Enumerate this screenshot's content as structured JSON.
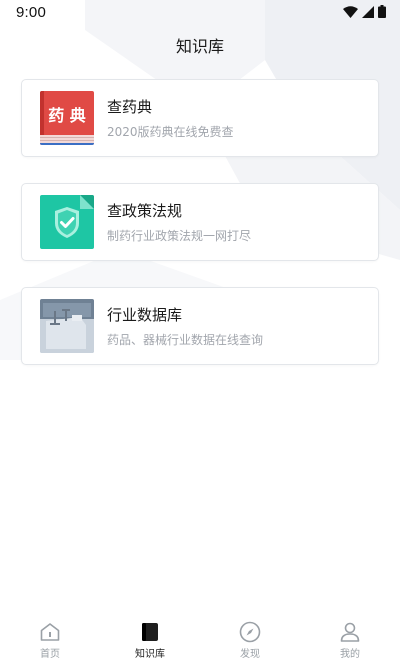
{
  "status_bar": {
    "time": "9:00"
  },
  "header": {
    "title": "知识库"
  },
  "cards": [
    {
      "title": "查药典",
      "description": "2020版药典在线免费查",
      "icon": "pharmacopoeia-book-icon",
      "icon_text": "药 典",
      "icon_color": "#e04a45"
    },
    {
      "title": "查政策法规",
      "description": "制药行业政策法规一网打尽",
      "icon": "policy-shield-check-icon",
      "icon_color": "#1ec6a4"
    },
    {
      "title": "行业数据库",
      "description": "药品、器械行业数据在线查询",
      "icon": "industry-database-icon",
      "icon_color": "#8a9bb0"
    }
  ],
  "tabbar": {
    "active": "knowledge",
    "tabs": [
      {
        "id": "home",
        "label": "首页",
        "icon": "home-icon"
      },
      {
        "id": "knowledge",
        "label": "知识库",
        "icon": "book-icon"
      },
      {
        "id": "discover",
        "label": "发现",
        "icon": "compass-icon"
      },
      {
        "id": "mine",
        "label": "我的",
        "icon": "person-icon"
      }
    ]
  },
  "colors": {
    "card_border": "#e3e6ea",
    "text_primary": "#1a1a1a",
    "text_secondary": "#a2a6ad",
    "tab_inactive": "#9aa0a6",
    "tab_active": "#1f1f1f"
  }
}
